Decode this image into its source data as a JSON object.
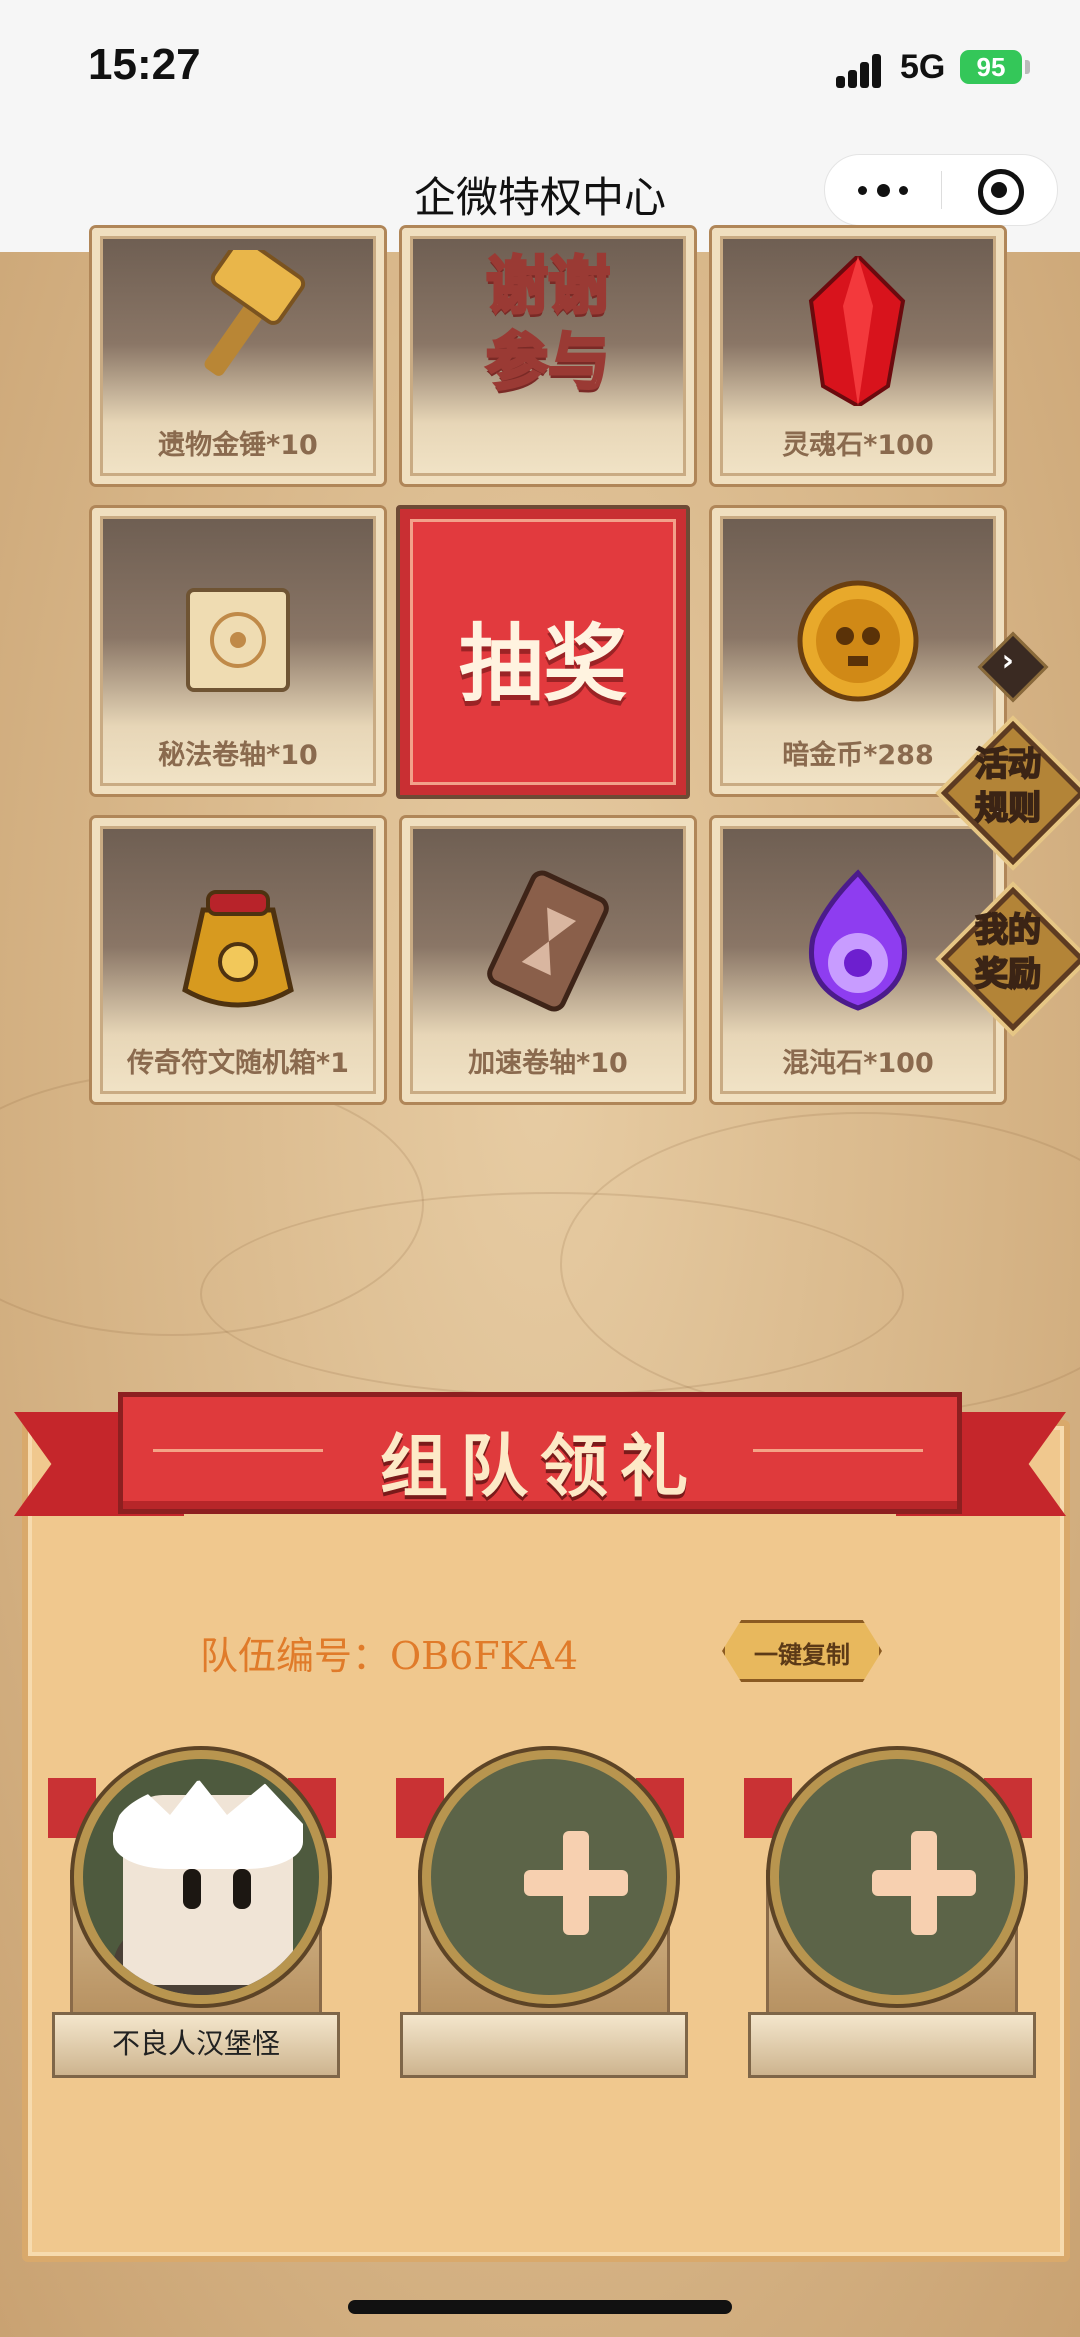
{
  "status_bar": {
    "time": "15:27",
    "network": "5G",
    "battery": "95"
  },
  "nav": {
    "title": "企微特权中心"
  },
  "prizes": [
    {
      "label": "遗物金锤*10",
      "icon": "golden-hammer-icon"
    },
    {
      "label": "谢谢参与",
      "line1": "谢谢",
      "line2": "参与"
    },
    {
      "label": "灵魂石*100",
      "icon": "red-crystal-icon"
    },
    {
      "label": "秘法卷轴*10",
      "icon": "arcane-scroll-icon"
    },
    {
      "label": "暗金币*288",
      "icon": "skull-coin-icon"
    },
    {
      "label": "传奇符文随机箱*1",
      "icon": "rune-bag-icon"
    },
    {
      "label": "加速卷轴*10",
      "icon": "hourglass-scroll-icon"
    },
    {
      "label": "混沌石*100",
      "icon": "chaos-stone-icon"
    }
  ],
  "draw_button": {
    "label": "抽奖"
  },
  "side_buttons": {
    "rules": {
      "line1": "活动",
      "line2": "规则"
    },
    "rewards": {
      "line1": "我的",
      "line2": "奖励"
    }
  },
  "team": {
    "title": "组队领礼",
    "label": "队伍编号：",
    "code": "OB6FKA4",
    "copy_button": "一键复制",
    "members": [
      {
        "name": "不良人汉堡怪"
      }
    ]
  },
  "colors": {
    "accent_red": "#df3a3c",
    "panel": "#f0c88e",
    "label_orange": "#e07b2a"
  }
}
